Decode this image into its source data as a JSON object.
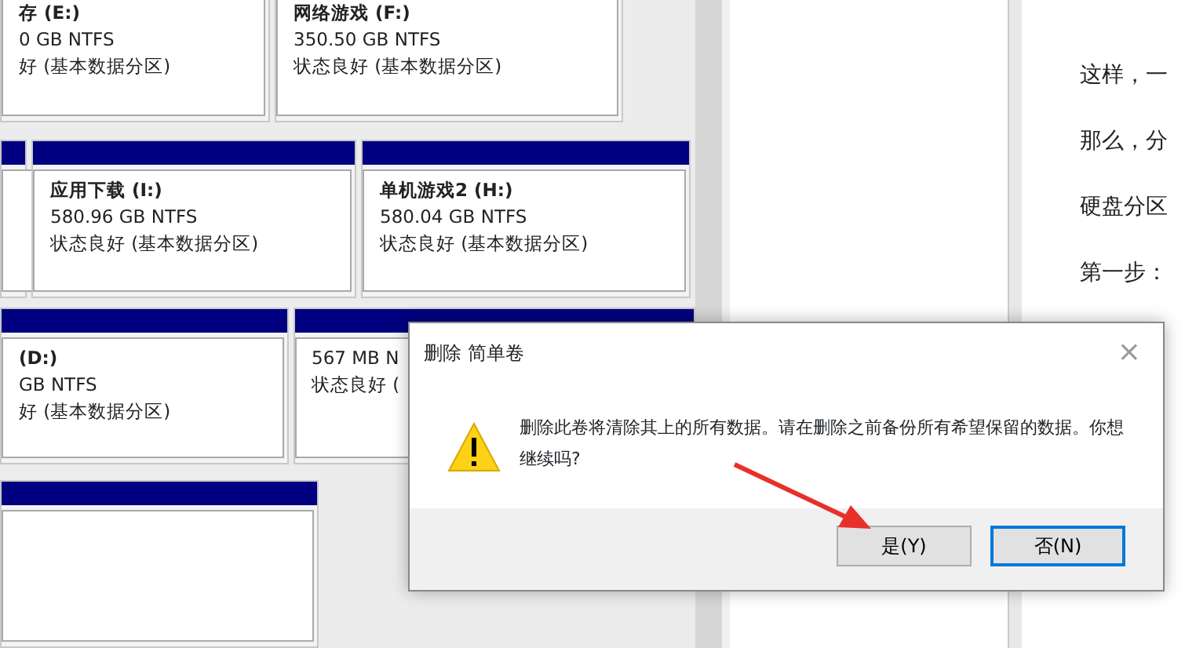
{
  "disk_rows": [
    {
      "bar": false,
      "volumes": [
        {
          "kind": "volume",
          "title": "存 (E:)",
          "size": "0 GB NTFS",
          "status": "好 (基本数据分区)"
        },
        {
          "kind": "volume",
          "title": "网络游戏 (F:)",
          "size": "350.50 GB NTFS",
          "status": "状态良好 (基本数据分区)"
        }
      ]
    },
    {
      "bar": true,
      "volumes": [
        {
          "kind": "blank"
        },
        {
          "kind": "volume",
          "title": "应用下载 (I:)",
          "size": "580.96 GB NTFS",
          "status": "状态良好 (基本数据分区)"
        },
        {
          "kind": "volume",
          "title": "单机游戏2 (H:)",
          "size": "580.04 GB NTFS",
          "status": "状态良好 (基本数据分区)"
        }
      ]
    },
    {
      "bar": true,
      "volumes": [
        {
          "kind": "volume",
          "title": "(D:)",
          "size": "GB NTFS",
          "status": "好 (基本数据分区)"
        },
        {
          "kind": "volume",
          "size": "567 MB N",
          "status": "状态良好 ("
        }
      ]
    },
    {
      "bar": true,
      "volumes": [
        {
          "kind": "blank"
        }
      ]
    }
  ],
  "article": {
    "lines": [
      "这样，一",
      "那么，分",
      "硬盘分区",
      "第一步："
    ]
  },
  "dialog": {
    "title": "删除 简单卷",
    "close": "×",
    "message": "删除此卷将清除其上的所有数据。请在删除之前备份所有希望保留的数据。你想继续吗?",
    "buttons": [
      {
        "label": "是(Y)",
        "focused": false
      },
      {
        "label": "否(N)",
        "focused": true
      }
    ]
  }
}
